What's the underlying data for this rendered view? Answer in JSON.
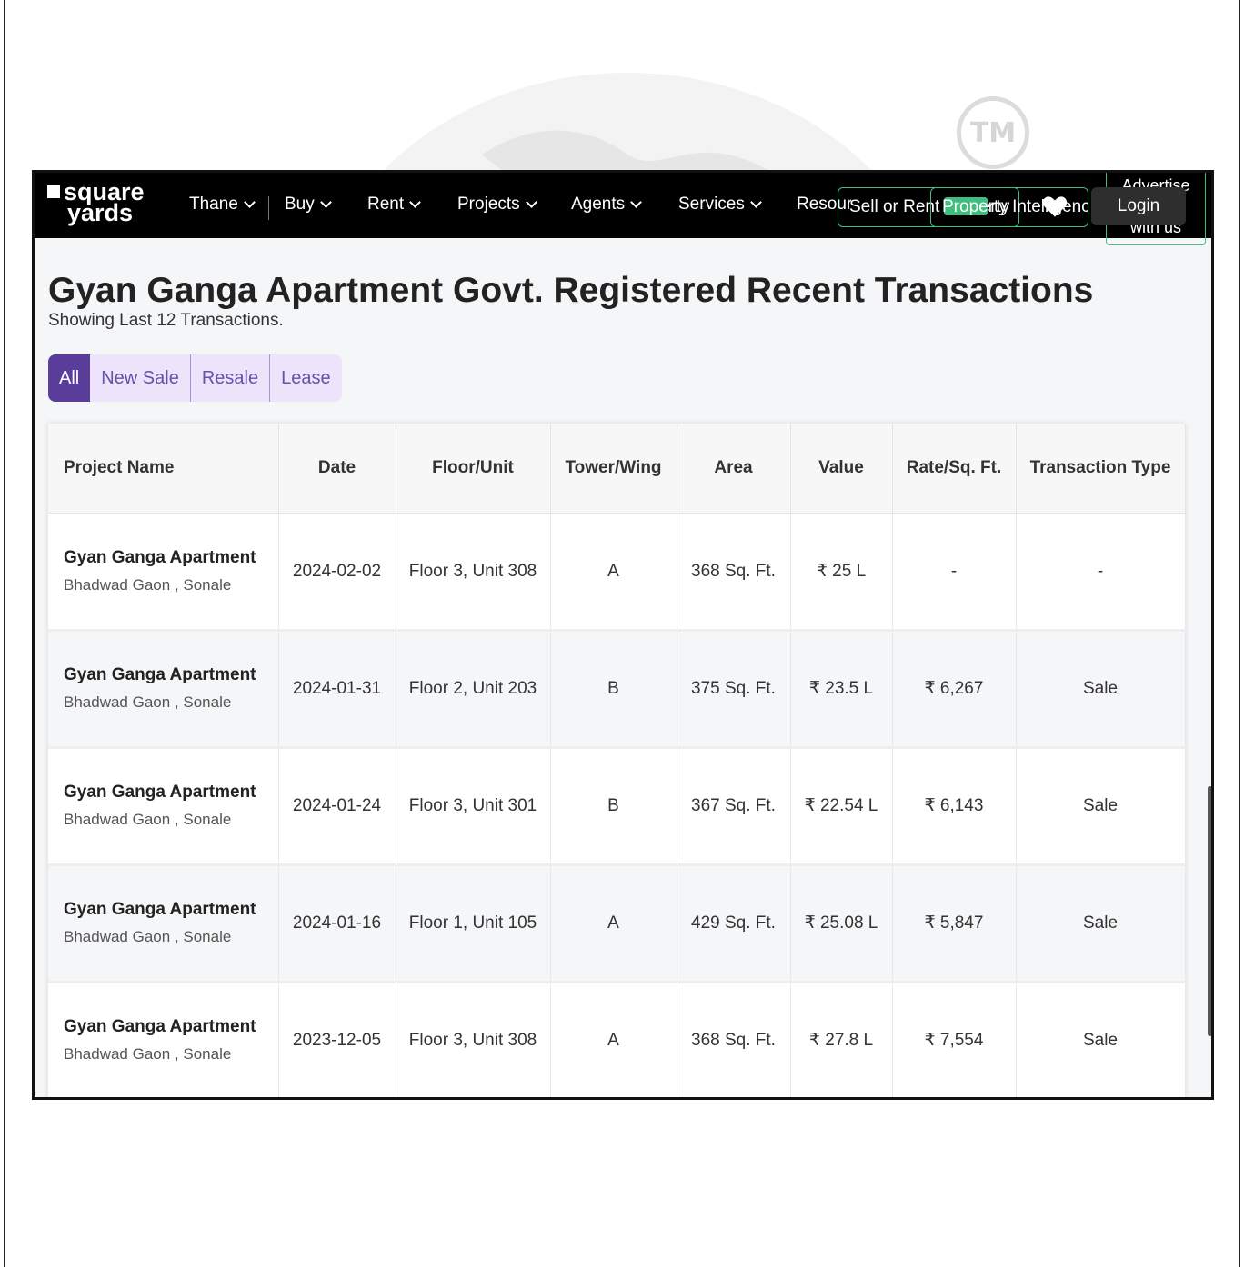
{
  "watermark": {
    "tm_label": "TM"
  },
  "navbar": {
    "logo_line1": "square",
    "logo_line2": "yards",
    "items": [
      {
        "label": "Thane"
      },
      {
        "label": "Buy"
      },
      {
        "label": "Rent"
      },
      {
        "label": "Projects"
      },
      {
        "label": "Agents"
      },
      {
        "label": "Services"
      },
      {
        "label": "Resources"
      }
    ],
    "sell_rent_label": "Sell or Rent Property",
    "property_intelligence_label": "Property Intelligence",
    "advertise_label": "Advertise with us",
    "login_label": "Login",
    "accent_color": "#3fbf7f"
  },
  "page": {
    "title": "Gyan Ganga Apartment Govt. Registered Recent Transactions",
    "subtitle": "Showing Last 12 Transactions.",
    "tabs": [
      {
        "label": "All",
        "active": true
      },
      {
        "label": "New Sale",
        "active": false
      },
      {
        "label": "Resale",
        "active": false
      },
      {
        "label": "Lease",
        "active": false
      }
    ],
    "tab_active_color": "#5a3d9a"
  },
  "table": {
    "headers": [
      "Project Name",
      "Date",
      "Floor/Unit",
      "Tower/Wing",
      "Area",
      "Value",
      "Rate/Sq. Ft.",
      "Transaction Type"
    ],
    "rows": [
      {
        "project": "Gyan Ganga Apartment",
        "location": "Bhadwad Gaon , Sonale",
        "date": "2024-02-02",
        "floor_unit": "Floor 3, Unit 308",
        "tower": "A",
        "area": "368 Sq. Ft.",
        "value": "₹ 25 L",
        "rate": "-",
        "type": "-"
      },
      {
        "project": "Gyan Ganga Apartment",
        "location": "Bhadwad Gaon , Sonale",
        "date": "2024-01-31",
        "floor_unit": "Floor 2, Unit 203",
        "tower": "B",
        "area": "375 Sq. Ft.",
        "value": "₹ 23.5 L",
        "rate": "₹ 6,267",
        "type": "Sale"
      },
      {
        "project": "Gyan Ganga Apartment",
        "location": "Bhadwad Gaon , Sonale",
        "date": "2024-01-24",
        "floor_unit": "Floor 3, Unit 301",
        "tower": "B",
        "area": "367 Sq. Ft.",
        "value": "₹ 22.54 L",
        "rate": "₹ 6,143",
        "type": "Sale"
      },
      {
        "project": "Gyan Ganga Apartment",
        "location": "Bhadwad Gaon , Sonale",
        "date": "2024-01-16",
        "floor_unit": "Floor 1, Unit 105",
        "tower": "A",
        "area": "429 Sq. Ft.",
        "value": "₹ 25.08 L",
        "rate": "₹ 5,847",
        "type": "Sale"
      },
      {
        "project": "Gyan Ganga Apartment",
        "location": "Bhadwad Gaon , Sonale",
        "date": "2023-12-05",
        "floor_unit": "Floor 3, Unit 308",
        "tower": "A",
        "area": "368 Sq. Ft.",
        "value": "₹ 27.8 L",
        "rate": "₹ 7,554",
        "type": "Sale"
      }
    ]
  }
}
